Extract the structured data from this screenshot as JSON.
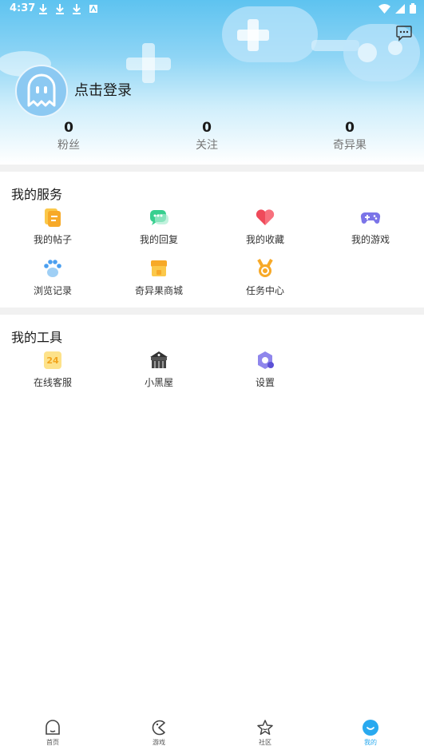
{
  "status_bar": {
    "time": "4:37"
  },
  "profile": {
    "login_label": "点击登录"
  },
  "stats": [
    {
      "value": "0",
      "label": "粉丝"
    },
    {
      "value": "0",
      "label": "关注"
    },
    {
      "value": "0",
      "label": "奇异果"
    }
  ],
  "services": {
    "title": "我的服务",
    "items": [
      {
        "label": "我的帖子",
        "icon": "posts-icon"
      },
      {
        "label": "我的回复",
        "icon": "replies-icon"
      },
      {
        "label": "我的收藏",
        "icon": "favorites-icon"
      },
      {
        "label": "我的游戏",
        "icon": "gamepad-icon"
      },
      {
        "label": "浏览记录",
        "icon": "paw-history-icon"
      },
      {
        "label": "奇异果商城",
        "icon": "store-icon"
      },
      {
        "label": "任务中心",
        "icon": "medal-icon"
      }
    ]
  },
  "tools": {
    "title": "我的工具",
    "items": [
      {
        "label": "在线客服",
        "icon": "customer-service-24-icon",
        "badge": "24"
      },
      {
        "label": "小黑屋",
        "icon": "dark-house-icon"
      },
      {
        "label": "设置",
        "icon": "settings-icon"
      }
    ]
  },
  "bottom_nav": [
    {
      "label": "首页",
      "icon": "home-icon"
    },
    {
      "label": "游戏",
      "icon": "games-icon"
    },
    {
      "label": "社区",
      "icon": "community-star-icon"
    },
    {
      "label": "我的",
      "icon": "profile-smile-icon",
      "active": true
    }
  ],
  "colors": {
    "accent": "#29a9ef",
    "separator": "#f1f1f1"
  }
}
